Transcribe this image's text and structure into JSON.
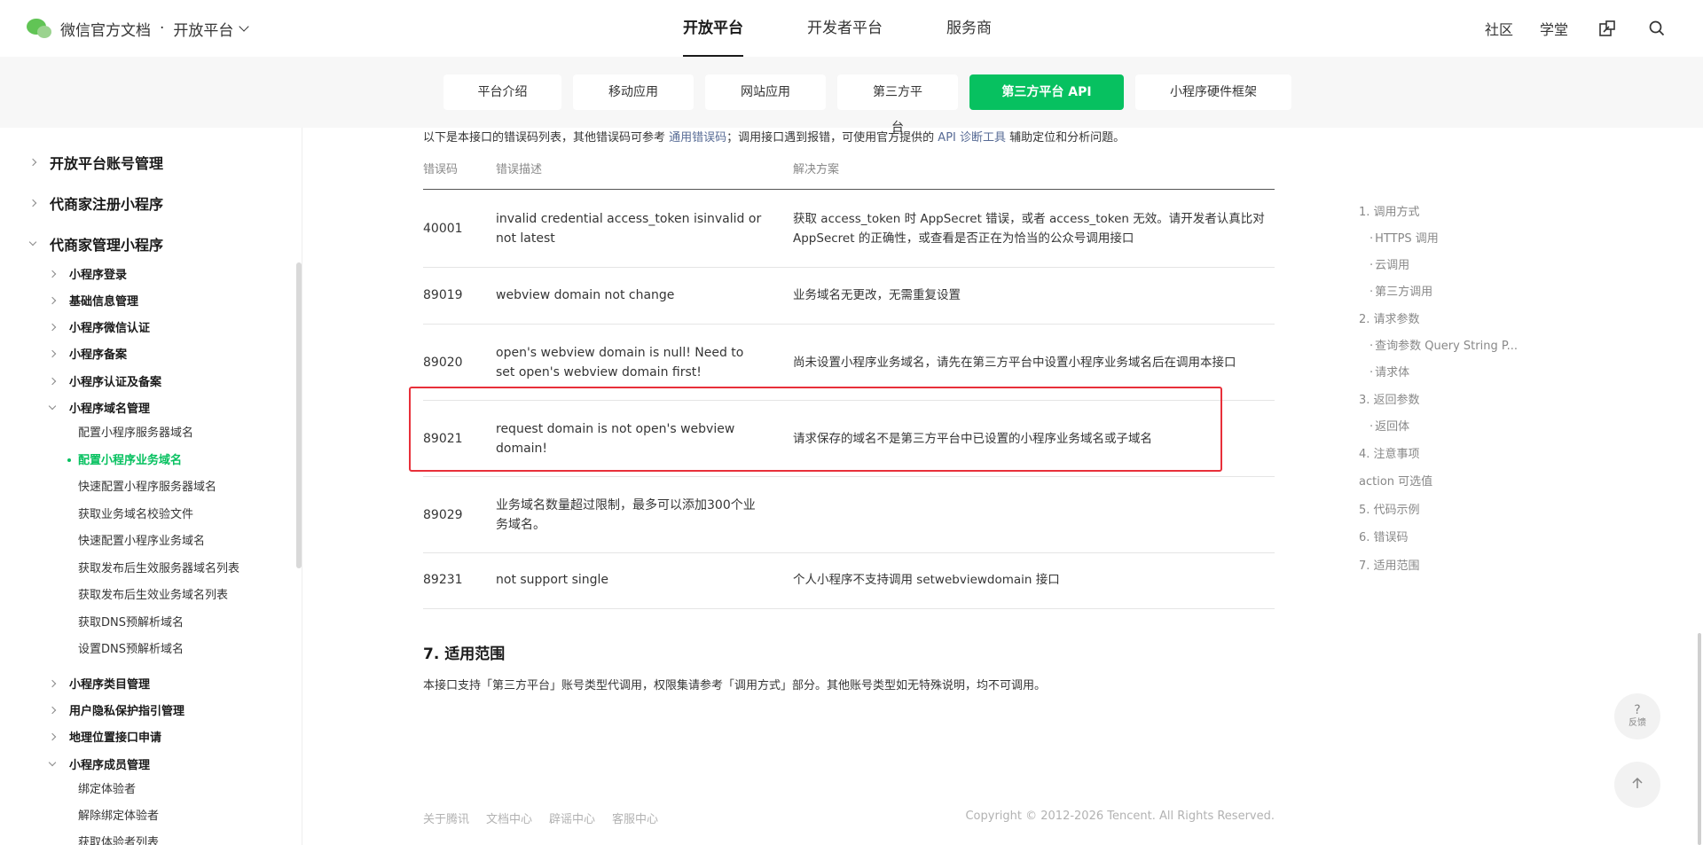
{
  "header": {
    "brand": "微信官方文档",
    "dot": "·",
    "platform": "开放平台",
    "nav": [
      "开放平台",
      "开发者平台",
      "服务商"
    ],
    "right_links": [
      "社区",
      "学堂"
    ]
  },
  "subnav": {
    "pills": [
      "平台介绍",
      "移动应用",
      "网站应用",
      "第三方平台",
      "第三方平台 API",
      "小程序硬件框架"
    ]
  },
  "sidebar": {
    "top_level": [
      "开放平台账号管理",
      "代商家注册小程序",
      "代商家管理小程序"
    ],
    "l2_a": [
      "小程序登录",
      "基础信息管理",
      "小程序微信认证",
      "小程序备案",
      "小程序认证及备案"
    ],
    "domain_group": "小程序域名管理",
    "domain_items": [
      "配置小程序服务器域名",
      "配置小程序业务域名",
      "快速配置小程序服务器域名",
      "获取业务域名校验文件",
      "快速配置小程序业务域名",
      "获取发布后生效服务器域名列表",
      "获取发布后生效业务域名列表",
      "获取DNS预解析域名",
      "设置DNS预解析域名"
    ],
    "l2_b": [
      "小程序类目管理",
      "用户隐私保护指引管理",
      "地理位置接口申请"
    ],
    "member_group": "小程序成员管理",
    "member_items": [
      "绑定体验者",
      "解除绑定体验者",
      "获取体验者列表"
    ]
  },
  "main": {
    "intro_prefix": "以下是本接口的错误码列表，其他错误码可参考 ",
    "intro_link1": "通用错误码",
    "intro_mid": "；调用接口遇到报错，可使用官方提供的 ",
    "intro_link2": "API 诊断工具",
    "intro_suffix": " 辅助定位和分析问题。",
    "table": {
      "headers": [
        "错误码",
        "错误描述",
        "解决方案"
      ],
      "rows": [
        {
          "code": "40001",
          "desc": "invalid credential  access_token isinvalid or not latest",
          "sol": "获取 access_token 时 AppSecret 错误，或者 access_token 无效。请开发者认真比对 AppSecret 的正确性，或查看是否正在为恰当的公众号调用接口"
        },
        {
          "code": "89019",
          "desc": "webview domain not change",
          "sol": "业务域名无更改，无需重复设置"
        },
        {
          "code": "89020",
          "desc": "open's webview domain is null! Need to set open's webview domain first!",
          "sol": "尚未设置小程序业务域名，请先在第三方平台中设置小程序业务域名后在调用本接口"
        },
        {
          "code": "89021",
          "desc": "request domain is not open's webview domain!",
          "sol": "请求保存的域名不是第三方平台中已设置的小程序业务域名或子域名"
        },
        {
          "code": "89029",
          "desc": "业务域名数量超过限制，最多可以添加300个业务域名。",
          "sol": ""
        },
        {
          "code": "89231",
          "desc": "not support single",
          "sol": "个人小程序不支持调用 setwebviewdomain 接口"
        }
      ]
    },
    "section_title": "7. 适用范围",
    "section_text": "本接口支持「第三方平台」账号类型代调用，权限集请参考「调用方式」部分。其他账号类型如无特殊说明，均不可调用。"
  },
  "toc": {
    "items": [
      "1. 调用方式",
      "HTTPS 调用",
      "云调用",
      "第三方调用",
      "2. 请求参数",
      "查询参数 Query String P...",
      "请求体",
      "3. 返回参数",
      "返回体",
      "4. 注意事项",
      "action 可选值",
      "5. 代码示例",
      "6. 错误码",
      "7. 适用范围"
    ]
  },
  "footer": {
    "links": [
      "关于腾讯",
      "文档中心",
      "辟谣中心",
      "客服中心"
    ],
    "copyright": "Copyright © 2012-2026 Tencent. All Rights Reserved."
  },
  "floating": {
    "feedback_symbol": "?",
    "feedback_label": "反馈"
  },
  "colors": {
    "accent": "#07c160",
    "link": "#576b95",
    "highlight": "#e8303a"
  },
  "icons": [
    "wechat-logo-icon",
    "chevron-down-icon",
    "external-link-icon",
    "search-icon",
    "arrow-up-icon",
    "chevron-right-icon"
  ]
}
